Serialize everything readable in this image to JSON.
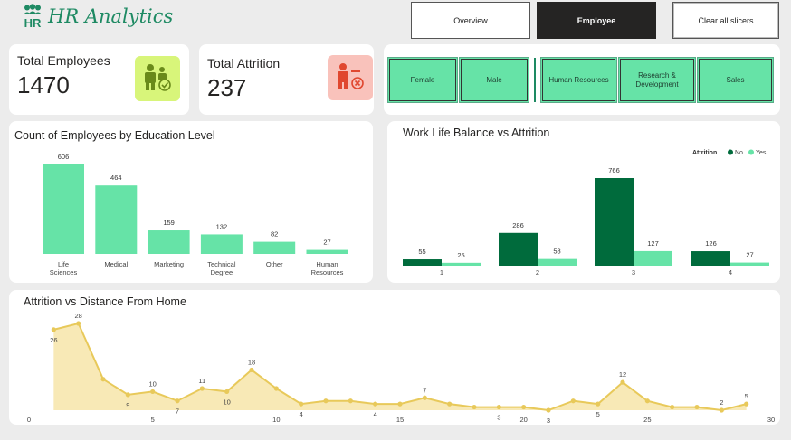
{
  "header": {
    "logo_mark": "HR",
    "title": "HR Analytics",
    "nav": {
      "overview": "Overview",
      "employee": "Employee",
      "clear": "Clear all slicers"
    }
  },
  "kpis": {
    "employees": {
      "title": "Total Employees",
      "value": "1470"
    },
    "attrition": {
      "title": "Total Attrition",
      "value": "237"
    }
  },
  "slicers": {
    "gender": [
      "Female",
      "Male"
    ],
    "department": [
      "Human Resources",
      "Research & Development",
      "Sales"
    ]
  },
  "colors": {
    "accent": "#1e8a63",
    "bar_light": "#66e3a7",
    "bar_dark": "#006b3c",
    "area_line": "#e8c95a",
    "area_fill": "#f8e9b6"
  },
  "charts": {
    "education": {
      "title": "Count of Employees by Education Level"
    },
    "worklife": {
      "title": "Work Life Balance vs Attrition",
      "legend_title": "Attrition",
      "legend": [
        "No",
        "Yes"
      ]
    },
    "distance": {
      "title": "Attrition vs Distance From Home"
    }
  },
  "chart_data": [
    {
      "type": "bar",
      "title": "Count of Employees by Education Level",
      "categories": [
        "Life Sciences",
        "Medical",
        "Marketing",
        "Technical Degree",
        "Other",
        "Human Resources"
      ],
      "values": [
        606,
        464,
        159,
        132,
        82,
        27
      ],
      "ylim": [
        0,
        606
      ],
      "grid": false
    },
    {
      "type": "bar",
      "title": "Work Life Balance vs Attrition",
      "categories": [
        "1",
        "2",
        "3",
        "4"
      ],
      "series": [
        {
          "name": "No",
          "values": [
            55,
            286,
            766,
            126
          ]
        },
        {
          "name": "Yes",
          "values": [
            25,
            58,
            127,
            27
          ]
        }
      ],
      "legend_title": "Attrition",
      "legend_position": "top-right",
      "ylim": [
        0,
        766
      ],
      "grid": false
    },
    {
      "type": "area",
      "title": "Attrition vs Distance From Home",
      "x": [
        1,
        2,
        3,
        4,
        5,
        6,
        7,
        8,
        9,
        10,
        11,
        12,
        13,
        14,
        15,
        16,
        17,
        18,
        19,
        20,
        21,
        22,
        23,
        24,
        25,
        26,
        27,
        28,
        29
      ],
      "values": [
        26,
        28,
        10,
        5,
        6,
        3,
        7,
        6,
        13,
        7,
        2,
        3,
        3,
        2,
        2,
        4,
        2,
        1,
        1,
        1,
        0,
        3,
        2,
        9,
        3,
        1,
        1,
        0,
        2
      ],
      "data_labels": [
        {
          "x": 1,
          "label": "26"
        },
        {
          "x": 2,
          "label": "28"
        },
        {
          "x": 4,
          "label": "9"
        },
        {
          "x": 5,
          "label": "10"
        },
        {
          "x": 6,
          "label": "7"
        },
        {
          "x": 7,
          "label": "11"
        },
        {
          "x": 8,
          "label": "10"
        },
        {
          "x": 9,
          "label": "18"
        },
        {
          "x": 11,
          "label": "4"
        },
        {
          "x": 14,
          "label": "4"
        },
        {
          "x": 16,
          "label": "7"
        },
        {
          "x": 19,
          "label": "3"
        },
        {
          "x": 21,
          "label": "3"
        },
        {
          "x": 23,
          "label": "5"
        },
        {
          "x": 24,
          "label": "12"
        },
        {
          "x": 28,
          "label": "2"
        },
        {
          "x": 29,
          "label": "5"
        }
      ],
      "xticks": [
        0,
        5,
        10,
        15,
        20,
        25,
        30
      ],
      "xlim": [
        0,
        30
      ],
      "grid": false
    }
  ]
}
